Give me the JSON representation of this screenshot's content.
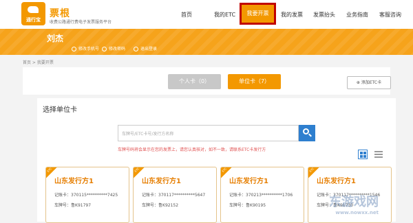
{
  "header": {
    "logo_label": "通行宝",
    "brand": "票根",
    "slogan": "收费公路通行费电子发票服务平台",
    "nav": [
      "首页",
      "我的ETC",
      "我要开票",
      "我的发票",
      "发票抬头",
      "业务指南",
      "客服咨询"
    ],
    "active_nav": "我要开票"
  },
  "banner": {
    "user_name": "刘杰",
    "links": [
      "修改手机号",
      "修改密码",
      "退出登录"
    ]
  },
  "breadcrumb": "首页 > 我要开票",
  "tabs": {
    "personal": "个人卡（0）",
    "company": "单位卡（7）",
    "add_etc": "添加ETC卡"
  },
  "panel": {
    "title": "选择单位卡",
    "search_placeholder": "车牌号/ETC卡号/发行方名称",
    "hint": "车牌号码将会显示在您的发票上，请您认真核对，如不一致，请联系ETC卡发行方"
  },
  "cards": [
    {
      "badge": "ETC",
      "issuer": "山东发行方1",
      "card_no_label": "记账卡：",
      "card_no": "370115**********7425",
      "plate_label": "车牌号：",
      "plate": "鲁K91797"
    },
    {
      "badge": "ETC",
      "issuer": "山东发行方1",
      "card_no_label": "记账卡：",
      "card_no": "370117**********5647",
      "plate_label": "车牌号：",
      "plate": "鲁K92152"
    },
    {
      "badge": "ETC",
      "issuer": "山东发行方1",
      "card_no_label": "记账卡：",
      "card_no": "370213**********1706",
      "plate_label": "车牌号：",
      "plate": "鲁K90195"
    },
    {
      "badge": "ETC",
      "issuer": "山东发行方1",
      "card_no_label": "记账卡：",
      "card_no": "370117**********1546",
      "plate_label": "车牌号：",
      "plate": "鲁K91730"
    }
  ],
  "watermark": {
    "main": "东游戏网",
    "sub": "www.nowxx.net"
  },
  "colors": {
    "accent": "#f39800",
    "active_border": "#c00000",
    "search_button": "#2e7fcf",
    "hint": "#e05050"
  }
}
